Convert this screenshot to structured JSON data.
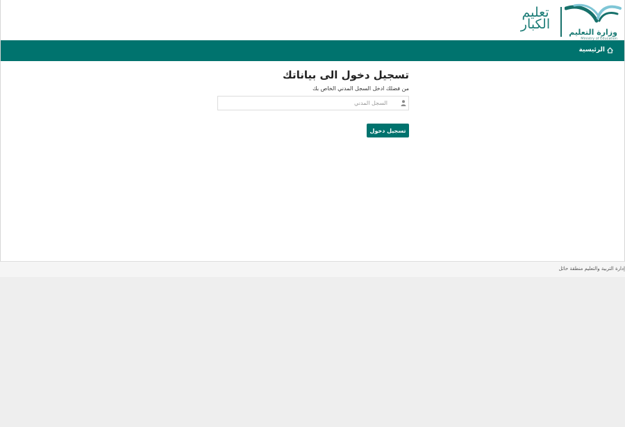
{
  "header": {
    "ministry_name_ar": "وزارة التعليم",
    "ministry_name_en": "Ministry of Education",
    "brand_line1": "تعليم",
    "brand_line2": "الكبار"
  },
  "navbar": {
    "home_label": "الرئيسية",
    "home_icon": "home-icon"
  },
  "login": {
    "title": "تسجيل دخول الى بياناتك",
    "subtitle": "من فضلك ادخل السجل المدني الخاص بك",
    "civil_id_placeholder": "السجل المدني",
    "civil_id_value": "",
    "input_icon": "user-icon",
    "submit_label": "تسجيل دخول"
  },
  "footer": {
    "text": "إدارة التربية والتعليم منطقة حائل"
  },
  "colors": {
    "primary": "#00736e",
    "brand_text": "#1d7d77",
    "logo_light": "#7fc6d6",
    "footer_bg": "#f5f5f5",
    "page_bg": "#eeeeee"
  }
}
